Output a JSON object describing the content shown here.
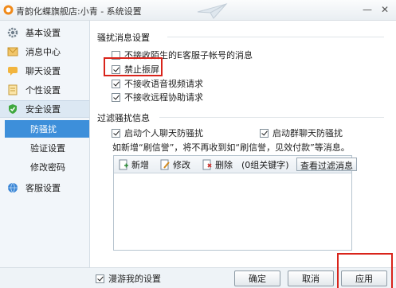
{
  "window": {
    "title": "青韵化蝶旗舰店:小青 - 系统设置",
    "minimize_label": "—",
    "close_label": "✕"
  },
  "sidebar": {
    "items": [
      {
        "label": "基本设置",
        "icon": "gear-icon"
      },
      {
        "label": "消息中心",
        "icon": "envelope-icon"
      },
      {
        "label": "聊天设置",
        "icon": "chat-icon"
      },
      {
        "label": "个性设置",
        "icon": "personal-icon"
      },
      {
        "label": "安全设置",
        "icon": "shield-icon"
      },
      {
        "label": "客服设置",
        "icon": "globe-icon"
      }
    ],
    "security_subitems": [
      "防骚扰",
      "验证设置",
      "修改密码"
    ]
  },
  "harassment": {
    "title": "骚扰消息设置",
    "options": [
      {
        "label": "不接收陌生的E客服子帐号的消息",
        "checked": false
      },
      {
        "label": "禁止振屏",
        "checked": true
      },
      {
        "label": "不接收语音视频请求",
        "checked": true
      },
      {
        "label": "不接收远程协助请求",
        "checked": true
      }
    ]
  },
  "filter": {
    "title": "过滤骚扰信息",
    "personal_label": "启动个人聊天防骚扰",
    "personal_checked": true,
    "group_label": "启动群聊天防骚扰",
    "group_checked": true,
    "hint": "如新增“刷信誉”，将不再收到如“刷信誉，见效付款”等消息。",
    "toolbar": {
      "add_label": "新增",
      "edit_label": "修改",
      "delete_label": "删除",
      "count_label": "(0组关键字)",
      "view_label": "查看过滤消息"
    }
  },
  "footer": {
    "roaming_label": "漫游我的设置",
    "roaming_checked": true,
    "ok_label": "确定",
    "cancel_label": "取消",
    "apply_label": "应用"
  },
  "colors": {
    "accent": "#3d8fda",
    "highlight_red": "#d9241b"
  }
}
